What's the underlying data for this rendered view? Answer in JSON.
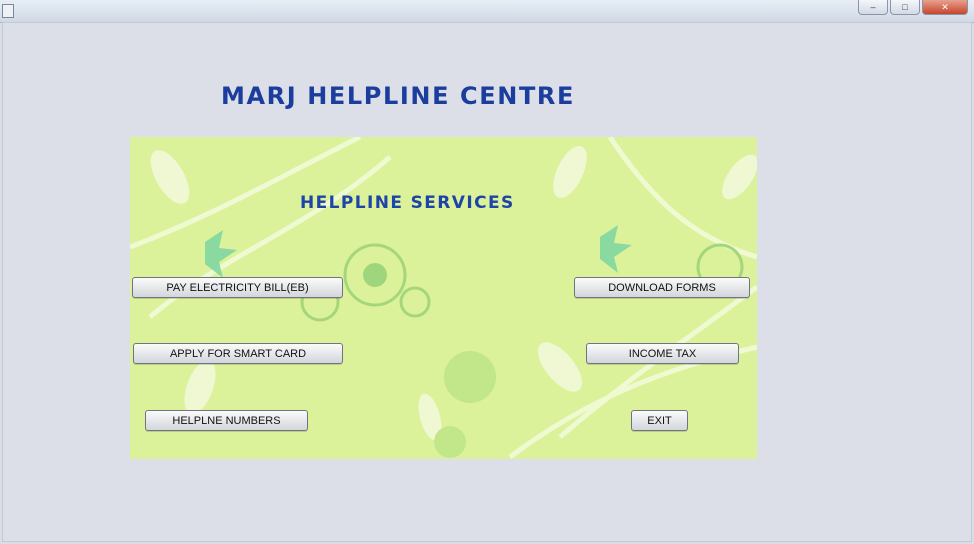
{
  "window": {
    "minimize_glyph": "–",
    "maximize_glyph": "□",
    "close_glyph": "✕"
  },
  "header": {
    "title": "MARJ HELPLINE CENTRE"
  },
  "panel": {
    "title": "HELPLINE SERVICES",
    "buttons": {
      "pay_electricity": "PAY ELECTRICITY BILL(EB)",
      "apply_smart_card": "APPLY FOR SMART CARD",
      "helpline_numbers": "HELPLNE NUMBERS",
      "download_forms": "DOWNLOAD FORMS",
      "income_tax": "INCOME TAX",
      "exit": "EXIT"
    }
  },
  "colors": {
    "title": "#1a3d9e",
    "panel_background": "#dcf29a",
    "window_background": "#d9dde6"
  }
}
